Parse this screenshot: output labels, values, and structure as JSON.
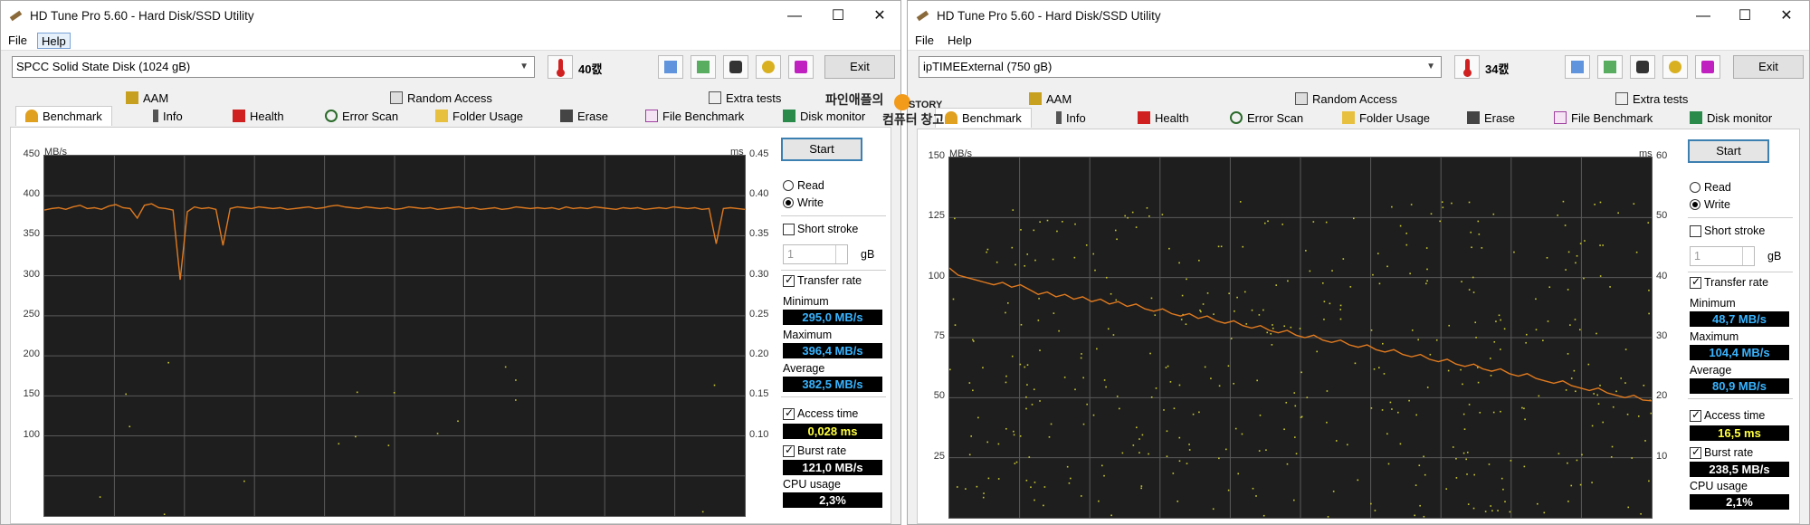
{
  "windows": [
    {
      "title": "HD Tune Pro 5.60 - Hard Disk/SSD Utility",
      "menu": [
        "File",
        "Help"
      ],
      "disk": "SPCC Solid State Disk (1024 gB)",
      "temperature": "40캜",
      "exit_label": "Exit",
      "tabs_top": [
        "AAM",
        "Random Access",
        "Extra tests"
      ],
      "tabs_bottom": [
        "Benchmark",
        "Info",
        "Health",
        "Error Scan",
        "Folder Usage",
        "Erase",
        "File Benchmark",
        "Disk monitor"
      ],
      "chart_left_unit": "MB/s",
      "chart_right_unit": "ms",
      "left_ticks": [
        "450",
        "400",
        "350",
        "300",
        "250",
        "200",
        "150",
        "100"
      ],
      "right_ticks": [
        "0.45",
        "0.40",
        "0.35",
        "0.30",
        "0.25",
        "0.20",
        "0.15",
        "0.10"
      ],
      "start_label": "Start",
      "read_label": "Read",
      "write_label": "Write",
      "mode": "write",
      "short_stroke_label": "Short stroke",
      "stroke_value": "1",
      "stroke_unit": "gB",
      "transfer_rate_label": "Transfer rate",
      "minimum_label": "Minimum",
      "minimum_value": "295,0 MB/s",
      "maximum_label": "Maximum",
      "maximum_value": "396,4 MB/s",
      "average_label": "Average",
      "average_value": "382,5 MB/s",
      "access_time_label": "Access time",
      "access_time_value": "0,028 ms",
      "burst_rate_label": "Burst rate",
      "burst_rate_value": "121,0 MB/s",
      "cpu_usage_label": "CPU usage",
      "cpu_usage_value": "2,3%"
    },
    {
      "title": "HD Tune Pro 5.60 - Hard Disk/SSD Utility",
      "menu": [
        "File",
        "Help"
      ],
      "disk": "ipTIMEExternal (750 gB)",
      "temperature": "34캜",
      "exit_label": "Exit",
      "tabs_top": [
        "AAM",
        "Random Access",
        "Extra tests"
      ],
      "tabs_bottom": [
        "Benchmark",
        "Info",
        "Health",
        "Error Scan",
        "Folder Usage",
        "Erase",
        "File Benchmark",
        "Disk monitor"
      ],
      "chart_left_unit": "MB/s",
      "chart_right_unit": "ms",
      "left_ticks": [
        "150",
        "125",
        "100",
        "75",
        "50",
        "25"
      ],
      "right_ticks": [
        "60",
        "50",
        "40",
        "30",
        "20",
        "10"
      ],
      "start_label": "Start",
      "read_label": "Read",
      "write_label": "Write",
      "mode": "write",
      "short_stroke_label": "Short stroke",
      "stroke_value": "1",
      "stroke_unit": "gB",
      "transfer_rate_label": "Transfer rate",
      "minimum_label": "Minimum",
      "minimum_value": "48,7 MB/s",
      "maximum_label": "Maximum",
      "maximum_value": "104,4 MB/s",
      "average_label": "Average",
      "average_value": "80,9 MB/s",
      "access_time_label": "Access time",
      "access_time_value": "16,5 ms",
      "burst_rate_label": "Burst rate",
      "burst_rate_value": "238,5 MB/s",
      "cpu_usage_label": "CPU usage",
      "cpu_usage_value": "2,1%"
    }
  ],
  "watermark": {
    "line1": "파인애플의",
    "line2": "컴퓨터 창고",
    "badge": "STORY"
  },
  "colors": {
    "transfer_line": "#e07a1f",
    "access_dots": "#c8c832",
    "chart_bg": "#1e1e1e",
    "grid": "#5a5a5a",
    "value_blue": "#39b4ff",
    "value_yellow": "#ffff40",
    "value_white": "#ffffff"
  },
  "chart_data": [
    {
      "type": "line",
      "xlabel": "",
      "ylabel": "MB/s",
      "y2label": "ms",
      "ylim": [
        0,
        450
      ],
      "y2lim": [
        0,
        0.45
      ],
      "series": [
        {
          "values": [
            382,
            384,
            385,
            383,
            386,
            388,
            384,
            385,
            383,
            387,
            389,
            385,
            384,
            372,
            388,
            390,
            385,
            384,
            382,
            295,
            380,
            386,
            384,
            385,
            383,
            338,
            384,
            386,
            385,
            384,
            386,
            385,
            384,
            385,
            383,
            384,
            385,
            386,
            384,
            385,
            387,
            388,
            386,
            385,
            384,
            386,
            385,
            384,
            385,
            383,
            384,
            386,
            385,
            384,
            385,
            383,
            384,
            385,
            386,
            384,
            385,
            383,
            384,
            385,
            383,
            384,
            386,
            385,
            384,
            385,
            384,
            385,
            383,
            386,
            384,
            385,
            384,
            386,
            385,
            384,
            383,
            385,
            384,
            385,
            383,
            384,
            385,
            384,
            386,
            385,
            384,
            385,
            383,
            384,
            340,
            384,
            385,
            384,
            383
          ]
        }
      ],
      "access_time_points_ms": []
    },
    {
      "type": "line",
      "xlabel": "",
      "ylabel": "MB/s",
      "y2label": "ms",
      "ylim": [
        0,
        150
      ],
      "y2lim": [
        0,
        60
      ],
      "series": [
        {
          "values": [
            104,
            101,
            100,
            99,
            98,
            97,
            98,
            96,
            97,
            95,
            93,
            94,
            92,
            93,
            91,
            92,
            90,
            91,
            89,
            90,
            88,
            89,
            87,
            86,
            87,
            85,
            84,
            85,
            83,
            84,
            82,
            81,
            82,
            80,
            79,
            80,
            78,
            77,
            78,
            76,
            75,
            76,
            74,
            73,
            74,
            72,
            71,
            72,
            70,
            69,
            70,
            68,
            67,
            68,
            66,
            65,
            66,
            64,
            63,
            64,
            62,
            61,
            62,
            60,
            59,
            60,
            58,
            57,
            56,
            57,
            55,
            54,
            53,
            54,
            52,
            51,
            50,
            51,
            49,
            48.7
          ]
        }
      ],
      "access_time_points_ms": []
    }
  ]
}
